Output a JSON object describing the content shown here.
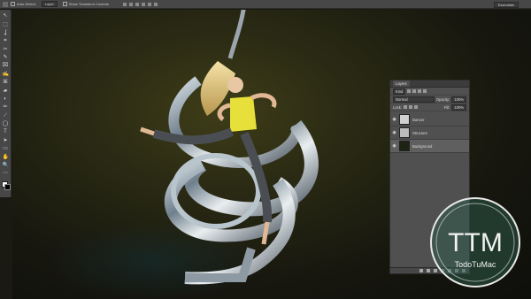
{
  "options_bar": {
    "auto_select_label": "Auto-Select:",
    "auto_select_value": "Layer",
    "transform_label": "Show Transform Controls",
    "workspace_label": "Essentials"
  },
  "tools": [
    "↖",
    "⬚",
    "ʆ",
    "⌗",
    "✂",
    "✎",
    "⌧",
    "✍",
    "⌘",
    "▰",
    "◐",
    "✏",
    "⟋",
    "◯",
    "T",
    "➤",
    "▭",
    "✋",
    "🔍",
    "⋯"
  ],
  "layers_panel": {
    "tab_label": "Layers",
    "filter_label": "Kind",
    "blend_mode": "Normal",
    "opacity_label": "Opacity:",
    "opacity_value": "100%",
    "lock_label": "Lock:",
    "fill_label": "Fill:",
    "fill_value": "100%",
    "layers": [
      {
        "name": "Dancer",
        "thumb_color": "#cfcfcf"
      },
      {
        "name": "Structure",
        "thumb_color": "#bdbdbd"
      },
      {
        "name": "Background",
        "thumb_color": "#1e2414"
      }
    ]
  },
  "watermark": {
    "initials": "TTM",
    "name": "TodoTuMac"
  },
  "colors": {
    "ui_gray": "#474747",
    "panel_gray": "#505050",
    "watermark_green": "#2e5a48"
  }
}
